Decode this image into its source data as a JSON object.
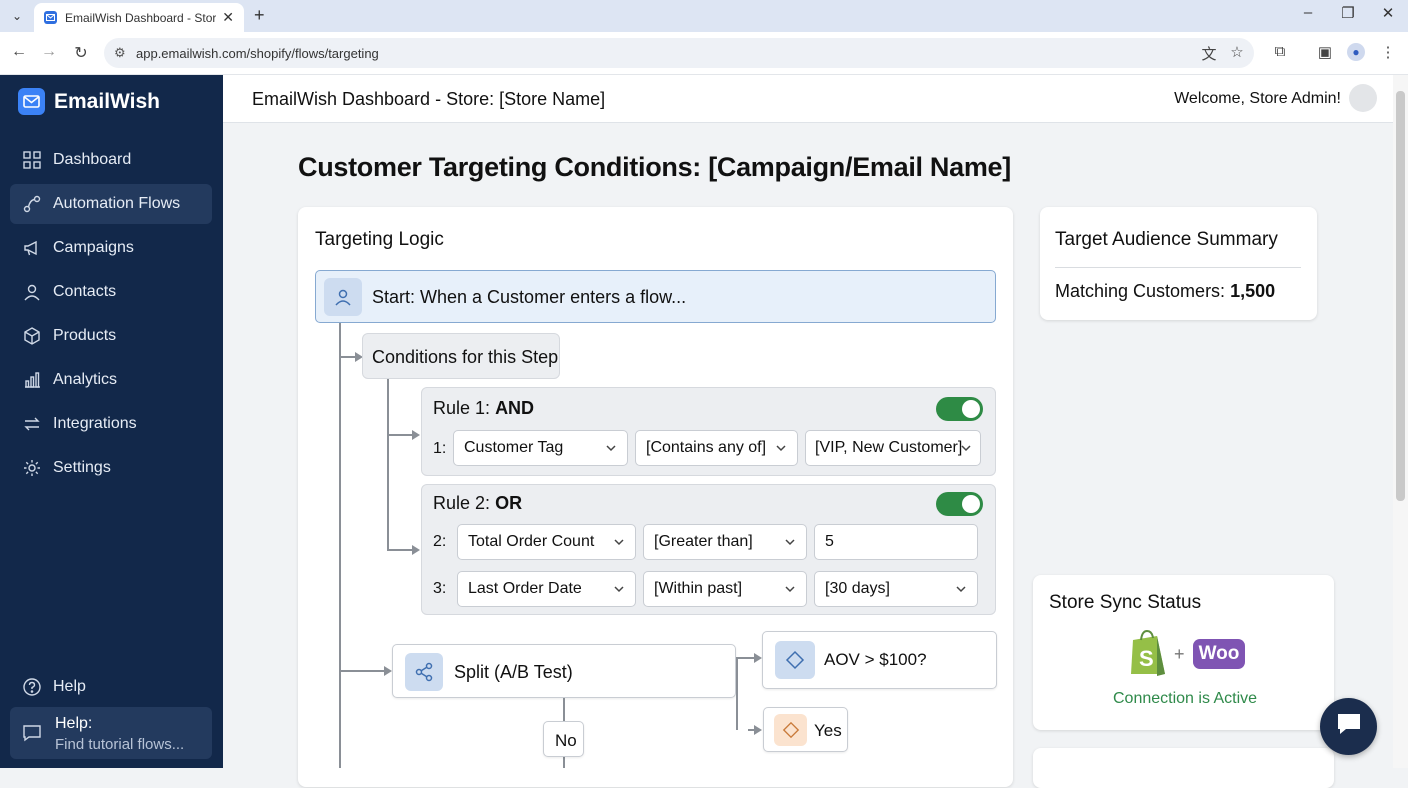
{
  "browser": {
    "tab_title": "EmailWish Dashboard - Store: [",
    "url": "app.emailwish.com/shopify/flows/targeting"
  },
  "app": {
    "brand": "EmailWish",
    "header_title": "EmailWish Dashboard - Store: [Store Name]",
    "welcome": "Welcome, Store Admin!"
  },
  "sidebar": {
    "items": [
      {
        "label": "Dashboard",
        "icon": "grid-icon"
      },
      {
        "label": "Automation Flows",
        "icon": "flow-icon",
        "active": true
      },
      {
        "label": "Campaigns",
        "icon": "megaphone-icon"
      },
      {
        "label": "Contacts",
        "icon": "person-icon"
      },
      {
        "label": "Products",
        "icon": "box-icon"
      },
      {
        "label": "Analytics",
        "icon": "bar-chart-icon"
      },
      {
        "label": "Integrations",
        "icon": "swap-icon"
      },
      {
        "label": "Settings",
        "icon": "gear-icon"
      }
    ],
    "help_label": "Help",
    "help_box_title": "Help:",
    "help_box_sub": "Find tutorial flows..."
  },
  "page": {
    "title": "Customer Targeting Conditions: [Campaign/Email Name]"
  },
  "logic": {
    "heading": "Targeting Logic",
    "start": "Start: When a Customer enters a flow...",
    "conditions": "Conditions for this Step",
    "rule1": {
      "prefix": "Rule 1:",
      "op": "AND",
      "enabled": true,
      "rows": [
        {
          "num": "1:",
          "field": "Customer Tag",
          "operator": "[Contains any of]",
          "value": "[VIP, New Customer]"
        }
      ]
    },
    "rule2": {
      "prefix": "Rule 2:",
      "op": "OR",
      "enabled": true,
      "rows": [
        {
          "num": "2:",
          "field": "Total Order Count",
          "operator": "[Greater than]",
          "value": "5"
        },
        {
          "num": "3:",
          "field": "Last Order Date",
          "operator": "[Within past]",
          "value": "[30 days]"
        }
      ]
    },
    "split": "Split (A/B Test)",
    "branch_top": "AOV > $100?",
    "branch_yes": "Yes",
    "branch_no": "No"
  },
  "summary": {
    "heading": "Target Audience Summary",
    "label": "Matching Customers:",
    "value": "1,500"
  },
  "sync": {
    "heading": "Store Sync Status",
    "woo": "Woo",
    "plus": "+",
    "status": "Connection is Active"
  },
  "colors": {
    "sidebar_bg": "#12284a",
    "accent": "#3b82f6",
    "toggle_on": "#2e8b45",
    "status_green": "#2f8a4a",
    "woo_purple": "#7f54b3",
    "shopify_green": "#95bf47"
  }
}
